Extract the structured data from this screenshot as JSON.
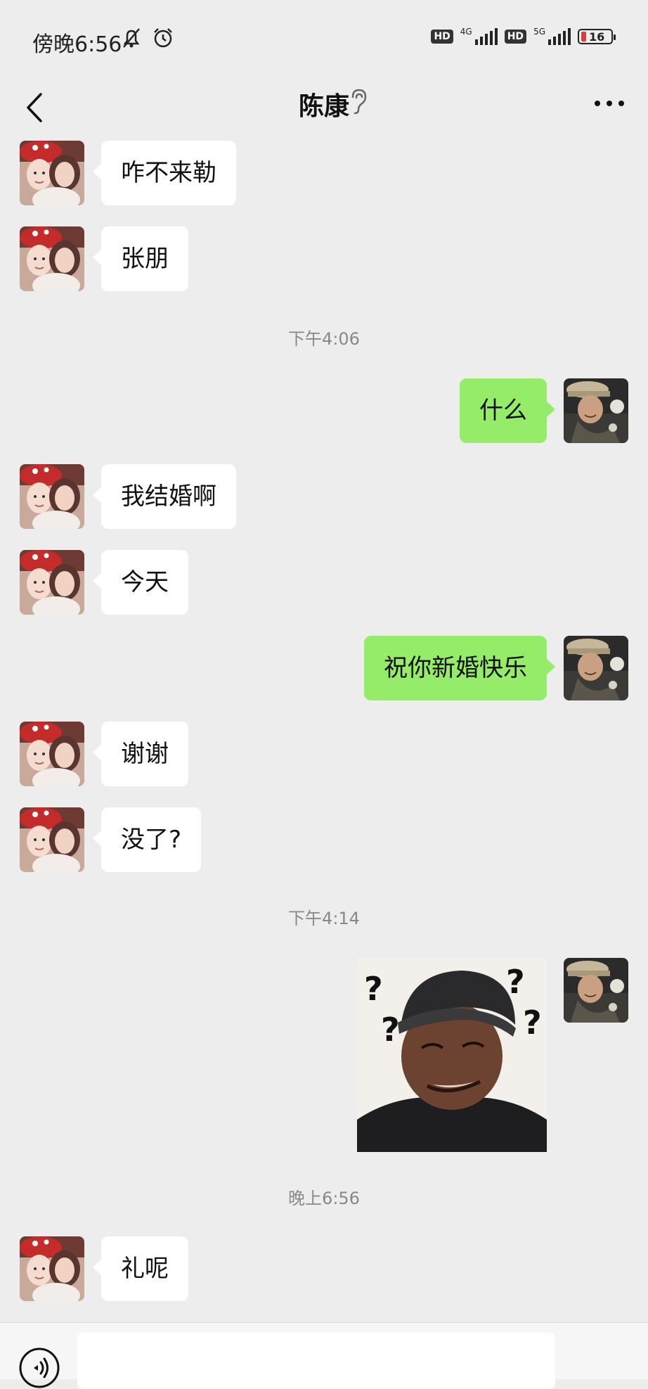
{
  "status_bar": {
    "time": "傍晚6:56",
    "net1": "4G",
    "net2": "5G",
    "hd": "HD",
    "battery": "16"
  },
  "header": {
    "title": "陈康"
  },
  "messages": [
    {
      "side": "left",
      "text": "咋不来勒"
    },
    {
      "side": "left",
      "text": "张朋"
    },
    {
      "side": "right",
      "text": "什么"
    },
    {
      "side": "left",
      "text": "我结婚啊"
    },
    {
      "side": "left",
      "text": "今天"
    },
    {
      "side": "right",
      "text": "祝你新婚快乐"
    },
    {
      "side": "left",
      "text": "谢谢"
    },
    {
      "side": "left",
      "text": "没了?"
    },
    {
      "side": "left",
      "text": "礼呢"
    }
  ],
  "timestamps": [
    "下午4:06",
    "下午4:14",
    "晚上6:56"
  ],
  "colors": {
    "background": "#ededed",
    "own_bubble": "#95ec69",
    "other_bubble": "#ffffff"
  }
}
